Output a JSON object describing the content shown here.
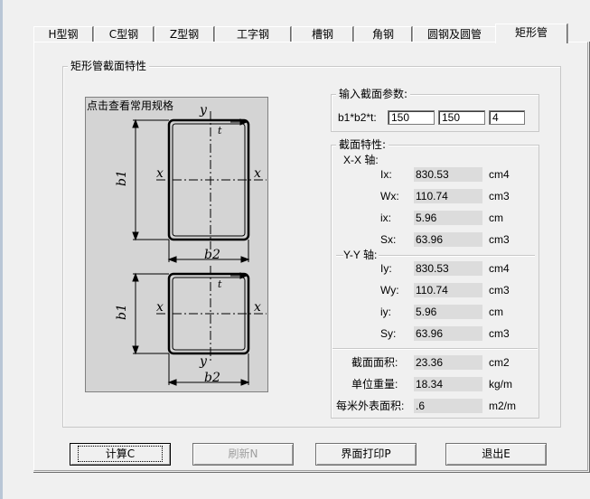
{
  "tabs": [
    {
      "label": "H型钢",
      "active": false
    },
    {
      "label": "C型钢",
      "active": false
    },
    {
      "label": "Z型钢",
      "active": false
    },
    {
      "label": "工字钢",
      "active": false
    },
    {
      "label": "槽钢",
      "active": false
    },
    {
      "label": "角钢",
      "active": false
    },
    {
      "label": "圆钢及圆管",
      "active": false
    },
    {
      "label": "矩形管",
      "active": true
    }
  ],
  "main_group_title": "矩形管截面特性",
  "drawing": {
    "link_text": "点击查看常用规格",
    "labels": {
      "y": "y",
      "x": "x",
      "t": "t",
      "b1": "b1",
      "b2": "b2"
    }
  },
  "input_group": {
    "title": "输入截面参数:",
    "label": "b1*b2*t:",
    "b1": "150",
    "b2": "150",
    "t": "4"
  },
  "props_group": {
    "title": "截面特性:",
    "xx_axis": "X-X 轴:",
    "yy_axis": "Y-Y 轴:",
    "xx": [
      {
        "label": "Ix:",
        "value": "830.53",
        "unit": "cm4"
      },
      {
        "label": "Wx:",
        "value": "110.74",
        "unit": "cm3"
      },
      {
        "label": "ix:",
        "value": "5.96",
        "unit": "cm"
      },
      {
        "label": "Sx:",
        "value": "63.96",
        "unit": "cm3"
      }
    ],
    "yy": [
      {
        "label": "Iy:",
        "value": "830.53",
        "unit": "cm4"
      },
      {
        "label": "Wy:",
        "value": "110.74",
        "unit": "cm3"
      },
      {
        "label": "iy:",
        "value": "5.96",
        "unit": "cm"
      },
      {
        "label": "Sy:",
        "value": "63.96",
        "unit": "cm3"
      }
    ],
    "extra": [
      {
        "label": "截面面积:",
        "value": "23.36",
        "unit": "cm2"
      },
      {
        "label": "单位重量:",
        "value": "18.34",
        "unit": "kg/m"
      },
      {
        "label": "每米外表面积:",
        "value": ".6",
        "unit": "m2/m"
      }
    ]
  },
  "buttons": {
    "calc": "计算C",
    "refresh": "刷新N",
    "print": "界面打印P",
    "exit": "退出E"
  }
}
